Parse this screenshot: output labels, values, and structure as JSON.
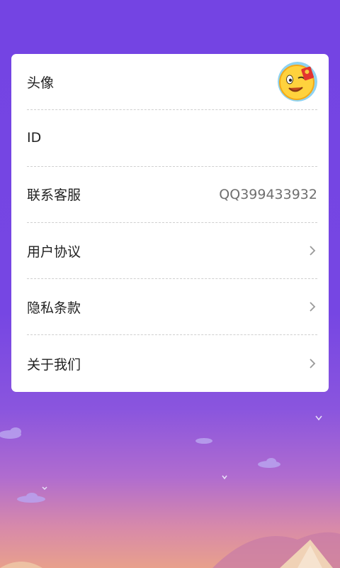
{
  "settings": {
    "rows": [
      {
        "label": "头像"
      },
      {
        "label": "ID"
      },
      {
        "label": "联系客服",
        "value": "QQ399433932"
      },
      {
        "label": "用户协议"
      },
      {
        "label": "隐私条款"
      },
      {
        "label": "关于我们"
      }
    ]
  },
  "colors": {
    "background_top": "#7444e3",
    "background_bottom": "#e8a08c",
    "card": "#ffffff",
    "text": "#222222",
    "value_text": "#6f6f6f",
    "chevron": "#9a9a9a"
  },
  "icons": {
    "avatar": "winking-emoji-avatar",
    "chevron": "chevron-right-icon"
  }
}
